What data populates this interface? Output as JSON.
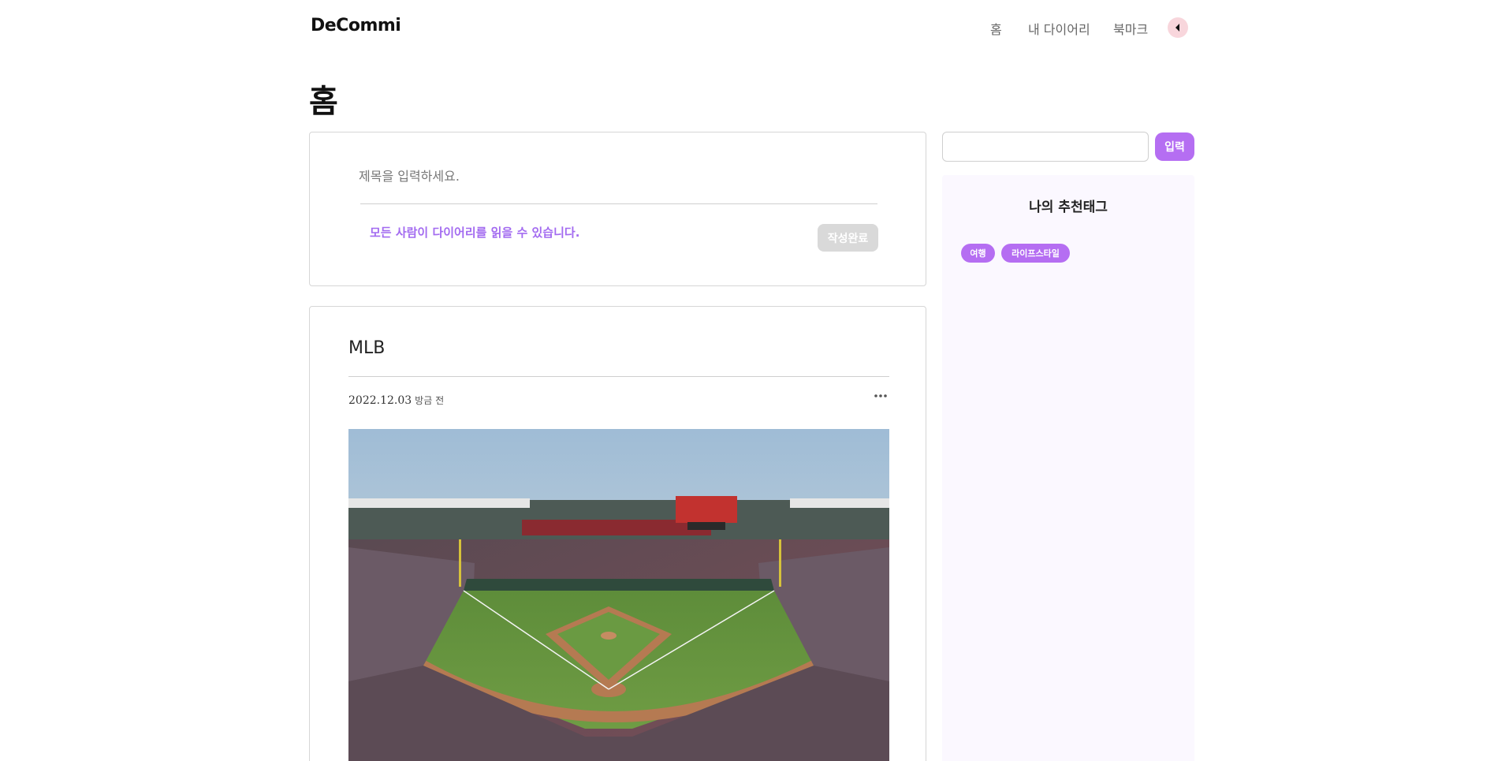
{
  "header": {
    "logo": "DeCommi",
    "nav": [
      {
        "label": "홈"
      },
      {
        "label": "내 다이어리"
      },
      {
        "label": "북마크"
      }
    ],
    "collapse_icon": "caret-left-icon"
  },
  "page": {
    "title": "홈"
  },
  "composer": {
    "title_placeholder": "제목을 입력하세요.",
    "visibility_text": "모든 사람이 다이어리를 읽을 수 있습니다.",
    "submit_label": "작성완료"
  },
  "post": {
    "title": "MLB",
    "date": "2022.12.03",
    "relative_time": "방금 전",
    "more_icon": "more-horizontal-icon",
    "image_subject": "baseball-stadium-photo"
  },
  "sidebar": {
    "search_value": "",
    "search_button_label": "입력",
    "tags_title": "나의 추천태그",
    "tags": [
      "여행",
      "라이프스타일"
    ]
  },
  "colors": {
    "accent": "#b56ef2",
    "accent_text": "#a36bf0",
    "disabled_button": "#d9d9d9",
    "panel_bg": "#fbf8ff",
    "collapse_bg": "#f8d6dc"
  }
}
